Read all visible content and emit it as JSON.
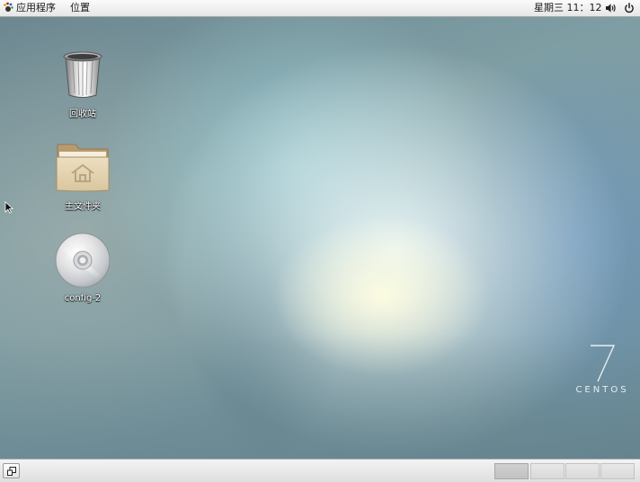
{
  "top_panel": {
    "applications_label": "应用程序",
    "places_label": "位置",
    "clock": "星期三 11：12",
    "icons": [
      "gnome-foot-icon",
      "volume-icon",
      "power-icon"
    ]
  },
  "desktop": {
    "icons": [
      {
        "label": "回收站",
        "icon": "trash-icon"
      },
      {
        "label": "主文件夹",
        "icon": "home-folder-icon"
      },
      {
        "label": "config-2",
        "icon": "optical-disc-icon"
      }
    ],
    "logo": {
      "number": "7",
      "text": "CENTOS"
    }
  },
  "bottom_panel": {
    "workspaces": 4,
    "active_workspace": 1,
    "icons": [
      "show-desktop-icon"
    ]
  },
  "colors": {
    "panel_bg": "#ececec",
    "panel_text": "#1a1a1a",
    "desktop_base": "#7b9aa2",
    "folder_tan": "#d8c7a2"
  }
}
